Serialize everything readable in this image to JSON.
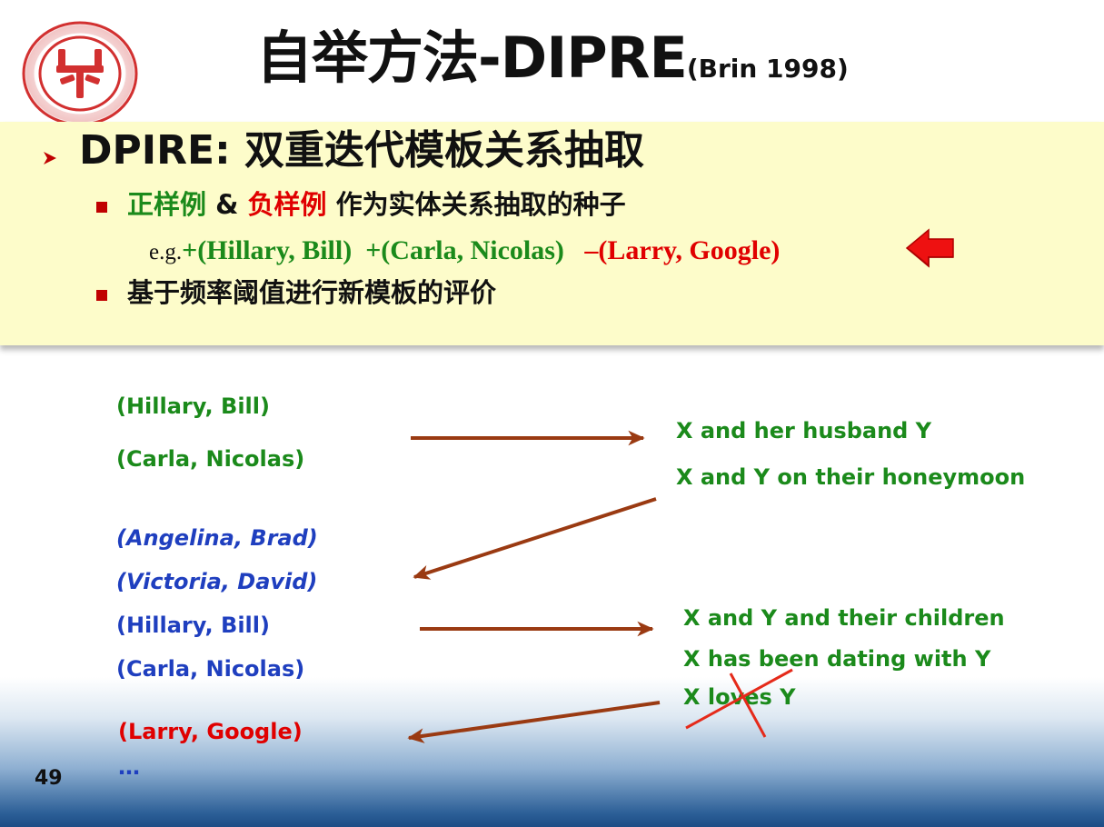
{
  "slide": {
    "title_main": "自举方法-DIPRE",
    "title_sub": "(Brin 1998)",
    "heading": "DPIRE: 双重迭代模板关系抽取",
    "bullet1": {
      "pos_label": "正样例",
      "amp": " & ",
      "neg_label": "负样例",
      "rest": " 作为实体关系抽取的种子"
    },
    "example": {
      "prefix": "e.g.",
      "pos1": "+(Hillary, Bill)",
      "pos2": "+(Carla, Nicolas)",
      "neg1": "–(Larry, Google)"
    },
    "bullet2": "基于频率阈值进行新模板的评价",
    "seeds": {
      "s1": "(Hillary, Bill)",
      "s2": "(Carla, Nicolas)"
    },
    "patterns_round1": {
      "p1": "X and her husband Y",
      "p2": "X and Y on their honeymoon"
    },
    "tuples": {
      "t1": "(Angelina, Brad)",
      "t2": "(Victoria, David)",
      "t3": "(Hillary,  Bill)",
      "t4": "(Carla, Nicolas)"
    },
    "patterns_round2": {
      "p1": "X and Y and their children",
      "p2": "X has been dating with Y",
      "p3": "X loves Y"
    },
    "negative_tuple": "(Larry, Google)",
    "ellipsis": "…",
    "page_number": "49"
  },
  "colors": {
    "positive": "#1b8a1b",
    "negative": "#e00000",
    "new_tuple": "#1f3fbf",
    "arrow": "#9a3a12",
    "panel": "#fdfcca"
  },
  "icons": [
    "university-logo-icon",
    "bullet-arrow-icon",
    "square-bullet-icon",
    "red-left-arrow-icon",
    "brown-arrow-icon",
    "cross-out-icon"
  ]
}
